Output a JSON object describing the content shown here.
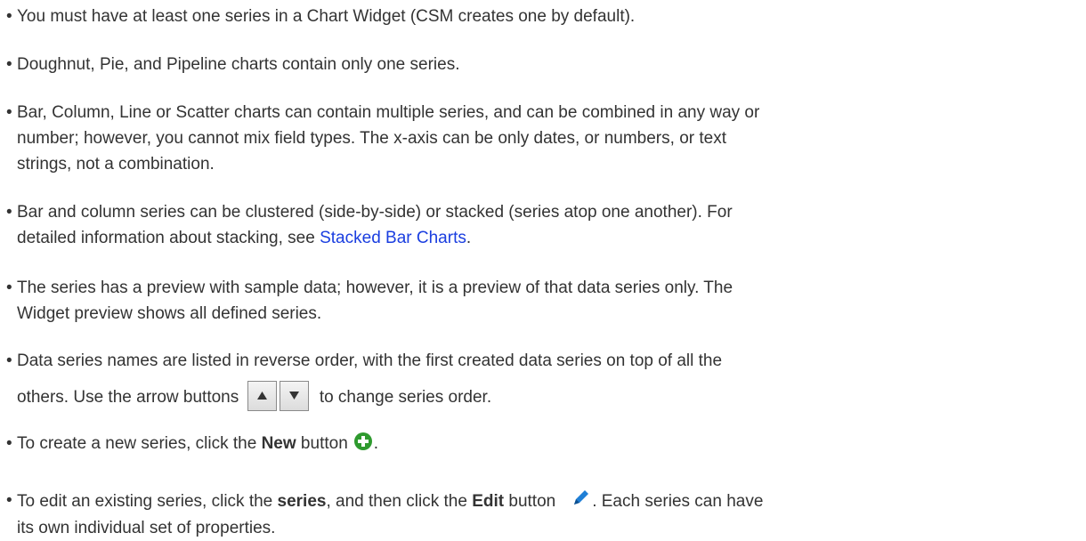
{
  "bullet_char": "•",
  "items": [
    {
      "text": "You must have at least one series in a Chart Widget (CSM creates one by default)."
    },
    {
      "text": "Doughnut, Pie, and Pipeline charts contain only one series."
    },
    {
      "line1": "Bar, Column, Line or Scatter charts can contain multiple series, and can be combined in any way or",
      "line2": "number; however, you cannot mix field types. The x-axis can be only dates, or numbers, or text",
      "line3": "strings, not a combination."
    },
    {
      "line1": "Bar and column series can be clustered (side-by-side) or stacked (series atop one another). For",
      "line2_before": "detailed information about stacking, see ",
      "link": "Stacked Bar Charts",
      "line2_after": "."
    },
    {
      "line1": "The series has a preview with sample data; however, it is a preview of that data series only. The",
      "line2": "Widget preview shows all defined series."
    },
    {
      "line1": "Data series names are listed in reverse order, with the first created data series on top of all the",
      "line2_before": "others. Use the arrow buttons",
      "line2_after": "to change series order.",
      "up_icon": "arrow-up-button-icon",
      "down_icon": "arrow-down-button-icon"
    },
    {
      "before": "To create a new series, click the ",
      "bold": "New",
      "after": " button",
      "end": ".",
      "icon": "plus-circle-icon",
      "icon_color": "#2e9a2e"
    },
    {
      "before": "To edit an existing series, click the ",
      "bold1": "series",
      "middle": ", and then click the ",
      "bold2": "Edit",
      "after": " button",
      "end": ". Each series can have",
      "line2": "its own individual set of properties.",
      "icon": "pencil-icon",
      "icon_color": "#1f7fd6"
    }
  ]
}
